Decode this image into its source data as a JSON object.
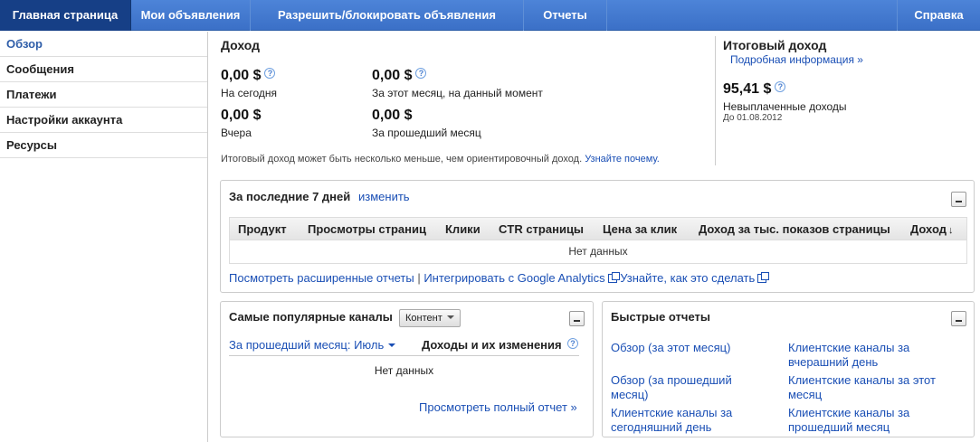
{
  "nav": {
    "tabs": [
      {
        "label": "Главная страница"
      },
      {
        "label": "Мои объявления"
      },
      {
        "label": "Разрешить/блокировать объявления"
      },
      {
        "label": "Отчеты"
      }
    ],
    "help": "Справка"
  },
  "sidebar": {
    "items": [
      {
        "label": "Обзор"
      },
      {
        "label": "Сообщения"
      },
      {
        "label": "Платежи"
      },
      {
        "label": "Настройки аккаунта"
      },
      {
        "label": "Ресурсы"
      }
    ]
  },
  "income": {
    "title": "Доход",
    "today_amount": "0,00 $",
    "today_label": "На сегодня",
    "month_amount": "0,00 $",
    "month_label": "За этот месяц, на данный момент",
    "yesterday_amount": "0,00 $",
    "yesterday_label": "Вчера",
    "last_month_amount": "0,00 $",
    "last_month_label": "За прошедший месяц",
    "note": "Итоговый доход может быть несколько меньше, чем ориентировочный доход.",
    "note_link": "Узнайте почему."
  },
  "final_income": {
    "title": "Итоговый доход",
    "details_link": "Подробная информация »",
    "amount": "95,41 $",
    "label": "Невыплаченные доходы",
    "date": "До 01.08.2012"
  },
  "last7": {
    "title": "За последние 7 дней",
    "change_link": "изменить",
    "columns": [
      "Продукт",
      "Просмотры страниц",
      "Клики",
      "CTR страницы",
      "Цена за клик",
      "Доход за тыс. показов страницы",
      "Доход"
    ],
    "no_data": "Нет данных",
    "link_reports": "Посмотреть расширенные отчеты",
    "link_ga": "Интегрировать с Google Analytics",
    "link_howto": "Узнайте, как это сделать"
  },
  "channels": {
    "title": "Самые популярные каналы",
    "dropdown": "Контент",
    "period": "За прошедший месяц: Июль",
    "col_income": "Доходы и их изменения",
    "no_data": "Нет данных",
    "full_report": "Просмотреть полный отчет »"
  },
  "quick": {
    "title": "Быстрые отчеты",
    "links": [
      "Обзор (за этот месяц)",
      "Клиентские каналы за вчерашний день",
      "Обзор (за прошедший месяц)",
      "Клиентские каналы за этот месяц",
      "Клиентские каналы за сегодняшний день",
      "Клиентские каналы за прошедший месяц"
    ]
  }
}
